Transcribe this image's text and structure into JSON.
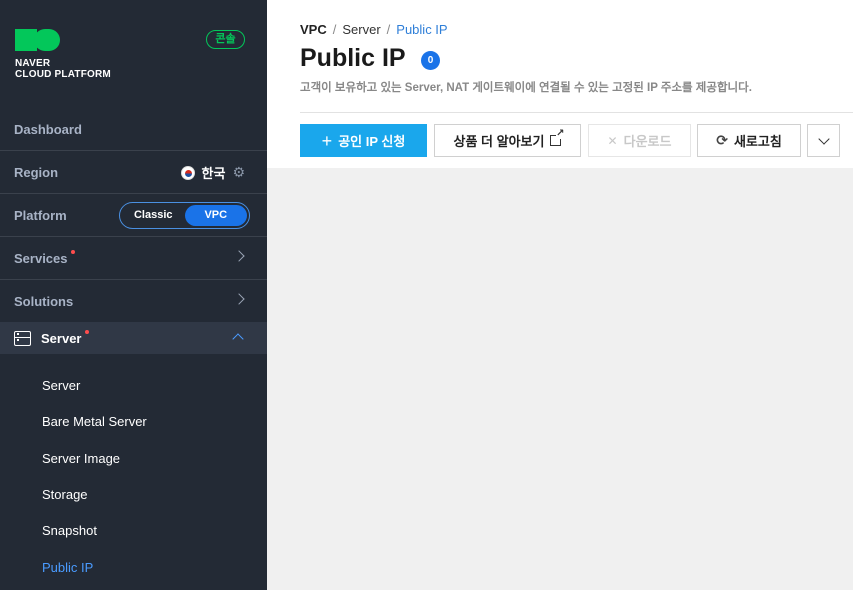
{
  "sidebar": {
    "logo_line1": "NAVER",
    "logo_line2": "CLOUD PLATFORM",
    "console_badge": "콘솔",
    "dashboard": "Dashboard",
    "region_label": "Region",
    "region_value": "한국",
    "platform_label": "Platform",
    "platform_options": [
      "Classic",
      "VPC"
    ],
    "platform_selected": "VPC",
    "services": "Services",
    "solutions": "Solutions",
    "server_section": "Server",
    "server_items": [
      "Server",
      "Bare Metal Server",
      "Server Image",
      "Storage",
      "Snapshot",
      "Public IP"
    ],
    "active_item": "Public IP"
  },
  "breadcrumb": [
    "VPC",
    "Server",
    "Public IP"
  ],
  "page": {
    "title": "Public IP",
    "count": "0",
    "description": "고객이 보유하고 있는 Server, NAT 게이트웨이에 연결될 수 있는 고정된 IP 주소를 제공합니다."
  },
  "toolbar": {
    "apply_label": "공인 IP 신청",
    "learn_more_label": "상품 더 알아보기",
    "download_label": "다운로드",
    "refresh_label": "새로고침"
  },
  "colors": {
    "sidebar_bg": "#232a35",
    "brand_green": "#03c75a",
    "primary_button": "#1aa7ec",
    "accent_blue": "#1a73e8",
    "active_link": "#4a9bff"
  }
}
